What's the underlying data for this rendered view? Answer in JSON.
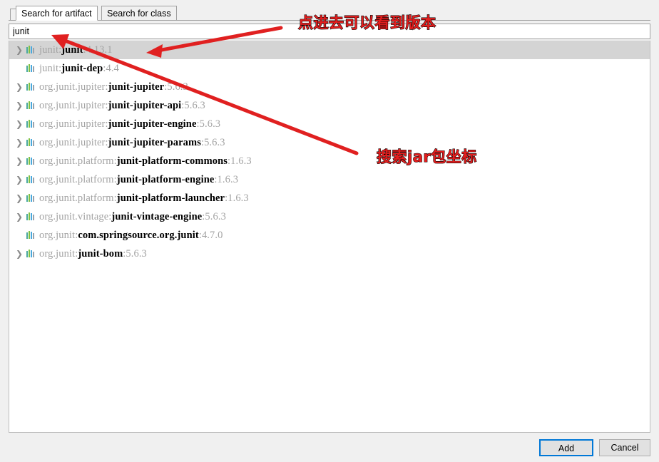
{
  "dialog": {
    "tabs": [
      {
        "label": "Search for artifact",
        "active": true
      },
      {
        "label": "Search for class",
        "active": false
      }
    ],
    "search": {
      "value": "junit",
      "placeholder": "Search for artifact"
    },
    "results": [
      {
        "expandable": true,
        "group": "junit",
        "artifact": "junit",
        "version": "4.13.1",
        "selected": true
      },
      {
        "expandable": false,
        "group": "junit",
        "artifact": "junit-dep",
        "version": "4.4",
        "selected": false
      },
      {
        "expandable": true,
        "group": "org.junit.jupiter",
        "artifact": "junit-jupiter",
        "version": "5.6.3",
        "selected": false
      },
      {
        "expandable": true,
        "group": "org.junit.jupiter",
        "artifact": "junit-jupiter-api",
        "version": "5.6.3",
        "selected": false
      },
      {
        "expandable": true,
        "group": "org.junit.jupiter",
        "artifact": "junit-jupiter-engine",
        "version": "5.6.3",
        "selected": false
      },
      {
        "expandable": true,
        "group": "org.junit.jupiter",
        "artifact": "junit-jupiter-params",
        "version": "5.6.3",
        "selected": false
      },
      {
        "expandable": true,
        "group": "org.junit.platform",
        "artifact": "junit-platform-commons",
        "version": "1.6.3",
        "selected": false
      },
      {
        "expandable": true,
        "group": "org.junit.platform",
        "artifact": "junit-platform-engine",
        "version": "1.6.3",
        "selected": false
      },
      {
        "expandable": true,
        "group": "org.junit.platform",
        "artifact": "junit-platform-launcher",
        "version": "1.6.3",
        "selected": false
      },
      {
        "expandable": true,
        "group": "org.junit.vintage",
        "artifact": "junit-vintage-engine",
        "version": "5.6.3",
        "selected": false
      },
      {
        "expandable": false,
        "group": "org.junit",
        "artifact": "com.springsource.org.junit",
        "version": "4.7.0",
        "selected": false
      },
      {
        "expandable": true,
        "group": "org.junit",
        "artifact": "junit-bom",
        "version": "5.6.3",
        "selected": false
      }
    ],
    "footer": {
      "add_label": "Add",
      "cancel_label": "Cancel"
    }
  },
  "annotations": {
    "version_note": "点进去可以看到版本",
    "search_note": "搜索jar包坐标",
    "color": "#e41e1e",
    "outline_color": "#000000"
  },
  "icons": {
    "chevron_right": "❯",
    "artifact_bars": "artifact-bars-icon"
  },
  "colors": {
    "selection": "#d4d4d4",
    "group_text": "#a3a3a3",
    "artifact_text": "#000000",
    "version_text": "#a3a3a3",
    "focus_border": "#0078d7",
    "dialog_bg": "#f0f0f0",
    "panel_bg": "#ffffff"
  }
}
